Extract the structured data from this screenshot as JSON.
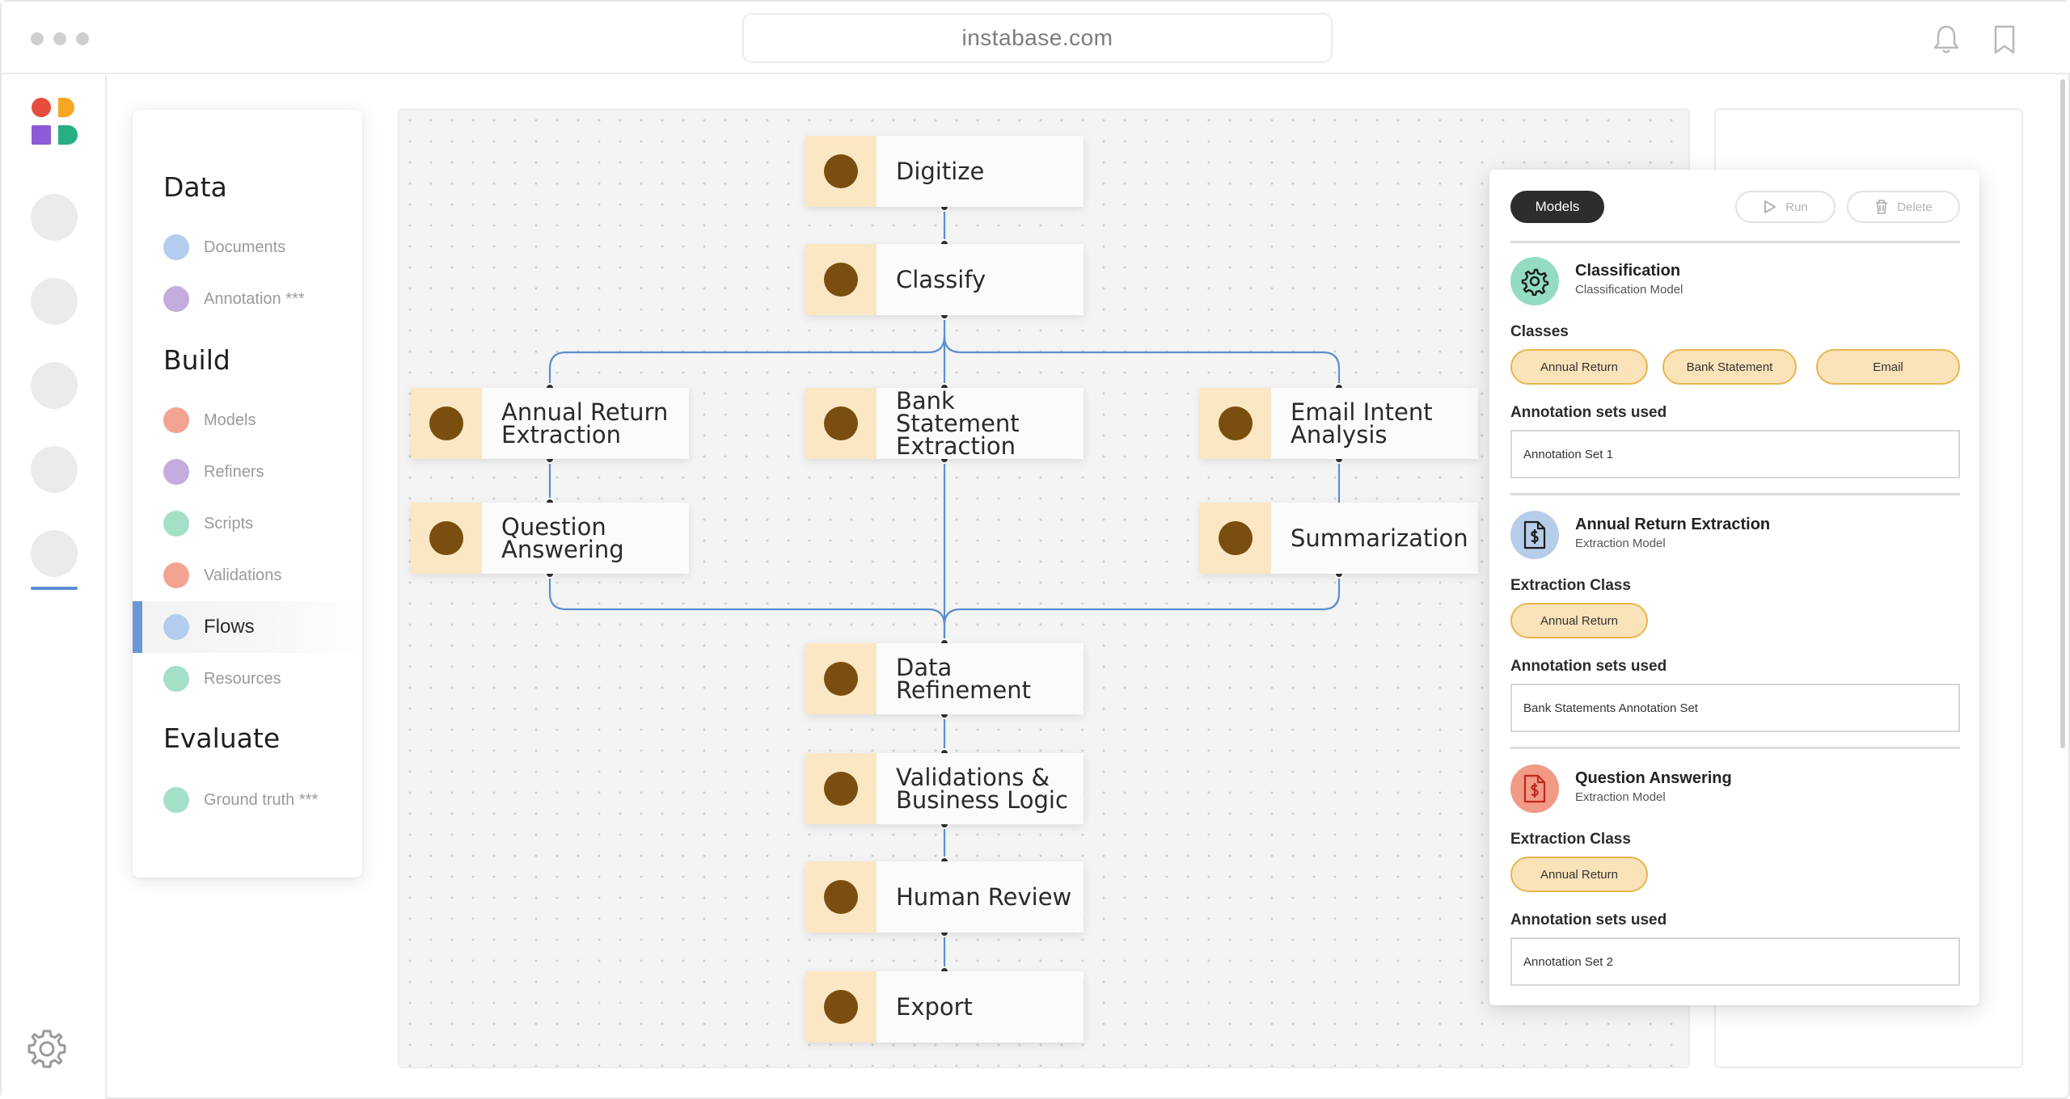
{
  "browser": {
    "url": "instabase.com",
    "icons": [
      "bell-icon",
      "bookmark-icon"
    ]
  },
  "rail": {
    "logo_colors": [
      "#e74c3c",
      "#f5a623",
      "#8e5bd6",
      "#27ae85"
    ],
    "icons": [
      "settings-gear-icon"
    ]
  },
  "nav": {
    "sections": [
      {
        "title": "Data",
        "items": [
          {
            "label": "Documents",
            "color": "#b3cdee"
          },
          {
            "label": "Annotation ***",
            "color": "#c4acde"
          }
        ]
      },
      {
        "title": "Build",
        "items": [
          {
            "label": "Models",
            "color": "#f3a391"
          },
          {
            "label": "Refiners",
            "color": "#c4acde"
          },
          {
            "label": "Scripts",
            "color": "#a4dfc8"
          },
          {
            "label": "Validations",
            "color": "#f3a391"
          },
          {
            "label": "Flows",
            "color": "#b3cdee",
            "active": true
          },
          {
            "label": "Resources",
            "color": "#a4dfc8"
          }
        ]
      },
      {
        "title": "Evaluate",
        "items": [
          {
            "label": "Ground truth ***",
            "color": "#a4dfc8"
          }
        ]
      }
    ]
  },
  "flow": {
    "accent_color": "#5b8fcf",
    "nodes": [
      {
        "id": "digitize",
        "label": "Digitize"
      },
      {
        "id": "classify",
        "label": "Classify"
      },
      {
        "id": "annual",
        "label": "Annual Return\nExtraction"
      },
      {
        "id": "bank",
        "label": "Bank Statement\nExtraction"
      },
      {
        "id": "email",
        "label": "Email Intent\nAnalysis"
      },
      {
        "id": "qa",
        "label": "Question\nAnswering"
      },
      {
        "id": "summ",
        "label": "Summarization"
      },
      {
        "id": "refine",
        "label": "Data Refinement"
      },
      {
        "id": "valid",
        "label": "Validations &\nBusiness Logic"
      },
      {
        "id": "review",
        "label": "Human Review"
      },
      {
        "id": "export",
        "label": "Export"
      }
    ]
  },
  "models_panel": {
    "tab_label": "Models",
    "run_label": "Run",
    "delete_label": "Delete",
    "models": [
      {
        "name": "Classification",
        "subtitle": "Classification Model",
        "icon": "gear-cog-icon",
        "icon_bg": "#93dcc2",
        "class_label": "Classes",
        "classes": [
          "Annual Return",
          "Bank Statement",
          "Email"
        ],
        "annotation_label": "Annotation sets used",
        "annotation_set": "Annotation Set 1"
      },
      {
        "name": "Annual Return Extraction",
        "subtitle": "Extraction Model",
        "icon": "dollar-document-icon",
        "icon_bg": "#b6cdea",
        "class_label": "Extraction Class",
        "classes": [
          "Annual Return"
        ],
        "annotation_label": "Annotation sets used",
        "annotation_set": "Bank Statements Annotation Set"
      },
      {
        "name": "Question Answering",
        "subtitle": "Extraction Model",
        "icon": "dollar-document-icon",
        "icon_bg": "#f19a86",
        "class_label": "Extraction Class",
        "classes": [
          "Annual Return"
        ],
        "annotation_label": "Annotation sets used",
        "annotation_set": "Annotation Set 2"
      }
    ]
  }
}
